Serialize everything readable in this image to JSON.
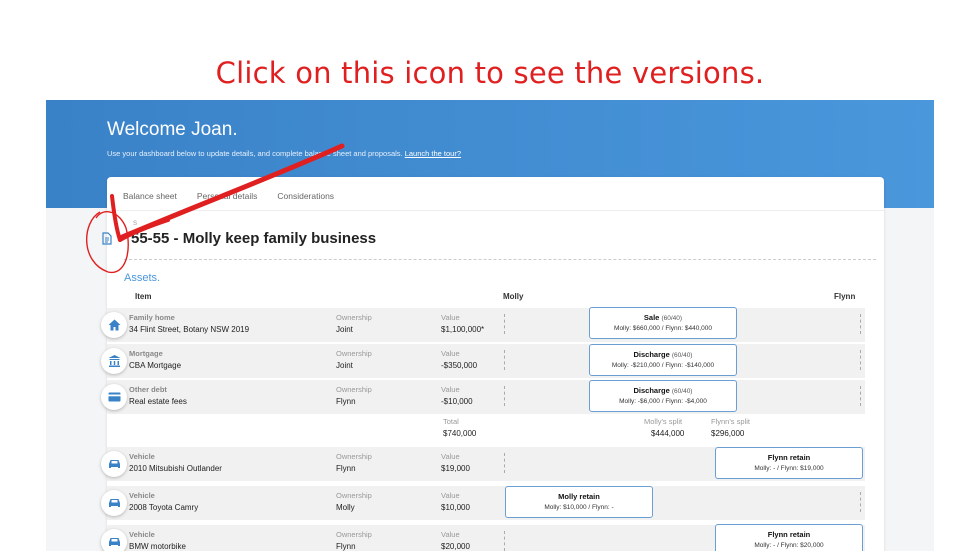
{
  "annotation": "Click on this icon to see the versions.",
  "header": {
    "welcome": "Welcome Joan.",
    "subtitle": "Use your dashboard below to update details, and complete balance sheet and proposals.",
    "tour_link": "Launch the tour?"
  },
  "tabs": [
    "Balance sheet",
    "Personal details",
    "Considerations"
  ],
  "scenario": {
    "small_label": "S",
    "title": "55-55 - Molly keep family business"
  },
  "assets": {
    "section_label": "Assets.",
    "columns": {
      "item": "Item",
      "molly": "Molly",
      "flynn": "Flynn"
    },
    "rows": [
      {
        "icon": "home-icon",
        "category": "Family home",
        "description": "34 Flint Street, Botany NSW 2019",
        "ownership_label": "Ownership",
        "ownership": "Joint",
        "value_label": "Value",
        "value": "$1,100,000*",
        "split": {
          "title": "Sale",
          "ratio": "(60/40)",
          "detail": "Molly: $660,000 / Flynn: $440,000"
        }
      },
      {
        "icon": "bank-icon",
        "category": "Mortgage",
        "description": "CBA Mortgage",
        "ownership_label": "Ownership",
        "ownership": "Joint",
        "value_label": "Value",
        "value": "-$350,000",
        "split": {
          "title": "Discharge",
          "ratio": "(60/40)",
          "detail": "Molly: -$210,000 / Flynn: -$140,000"
        }
      },
      {
        "icon": "card-icon",
        "category": "Other debt",
        "description": "Real estate fees",
        "ownership_label": "Ownership",
        "ownership": "Flynn",
        "value_label": "Value",
        "value": "-$10,000",
        "split": {
          "title": "Discharge",
          "ratio": "(60/40)",
          "detail": "Molly: -$6,000 / Flynn: -$4,000"
        }
      }
    ],
    "totals": {
      "total_label": "Total",
      "total": "$740,000",
      "molly_label": "Molly's split",
      "molly": "$444,000",
      "flynn_label": "Flynn's split",
      "flynn": "$296,000"
    },
    "vehicles": [
      {
        "icon": "car-icon",
        "category": "Vehicle",
        "description": "2010 Mitsubishi Outlander",
        "ownership_label": "Ownership",
        "ownership": "Flynn",
        "value_label": "Value",
        "value": "$19,000",
        "split": {
          "title": "Flynn retain",
          "detail": "Molly: - / Flynn: $19,000"
        }
      },
      {
        "icon": "car-icon",
        "category": "Vehicle",
        "description": "2008 Toyota Camry",
        "ownership_label": "Ownership",
        "ownership": "Molly",
        "value_label": "Value",
        "value": "$10,000",
        "split": {
          "title": "Molly retain",
          "detail": "Molly: $10,000 / Flynn: -"
        }
      },
      {
        "icon": "car-icon",
        "category": "Vehicle",
        "description": "BMW motorbike",
        "ownership_label": "Ownership",
        "ownership": "Flynn",
        "value_label": "Value",
        "value": "$20,000",
        "split": {
          "title": "Flynn retain",
          "detail": "Molly: - / Flynn: $20,000"
        }
      }
    ]
  },
  "colors": {
    "brand": "#4a97dc",
    "annotation": "#e02020"
  }
}
